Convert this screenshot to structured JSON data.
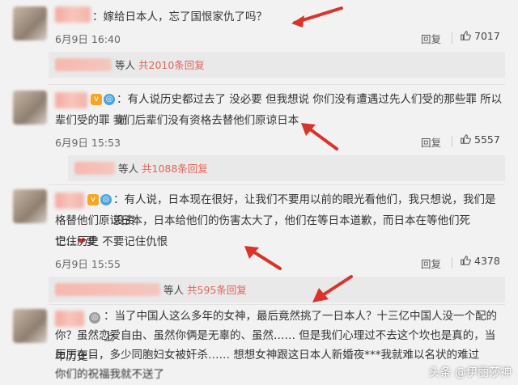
{
  "comments": [
    {
      "text": "：嫁给日本人，忘了国恨家仇了吗？",
      "date": "6月9日",
      "time": "16:40",
      "reply_label": "回复",
      "likes": "7017",
      "sub_who": "等人",
      "sub_count": "共2010条回复"
    },
    {
      "text_line1": "：有人说历史都过去了 没必要 但我想说 你们没有遭遇过先人们受的那些罪 所以 前",
      "text_line2": "辈们受的罪 我们后辈们没有资格去替他们原谅日本",
      "date": "6月9日",
      "time": "15:53",
      "reply_label": "回复",
      "likes": "5557",
      "sub_who": "等人",
      "sub_count": "共1088条回复"
    },
    {
      "text_line1": "：有人说，日本现在很好，让我们不要用以前的眼光看他们，我只想说，我们是没资",
      "text_line2": "格替他们原谅日本，日本给他们的伤害太大了，他们在等日本道歉，而日本在等他们死亡…",
      "text_line2_tail": "要",
      "text_line3": "记住历史 不要记住仇恨",
      "date": "6月9日",
      "time": "15:55",
      "reply_label": "回复",
      "likes": "4378",
      "sub_who": "等人",
      "sub_count": "共595条回复"
    },
    {
      "text_line1": "：当了中国人这么多年的女神，最后竟然挑了一日本人？十三亿中国人没一个配的上",
      "text_line2": "你？虽然恋爱自由、虽然你俩是无辜的、虽然…… 但是我们心理过不去这个坎也是真的，当年历史",
      "text_line3": "历历在目，多少同胞妇女被奸杀…… 想想女神跟这日本人新婚夜***我就难以名状的难过",
      "text_line4": "你们的祝福我就不送了"
    }
  ],
  "watermark": "头条 @伊丽莎神",
  "icons": {
    "like": "thumbs-up-icon",
    "heart": "heart-icon",
    "arrow": "red-arrow-icon"
  },
  "colors": {
    "arrow": "#d9342b",
    "count": "#e0645a",
    "background": "#f2f2f2"
  }
}
